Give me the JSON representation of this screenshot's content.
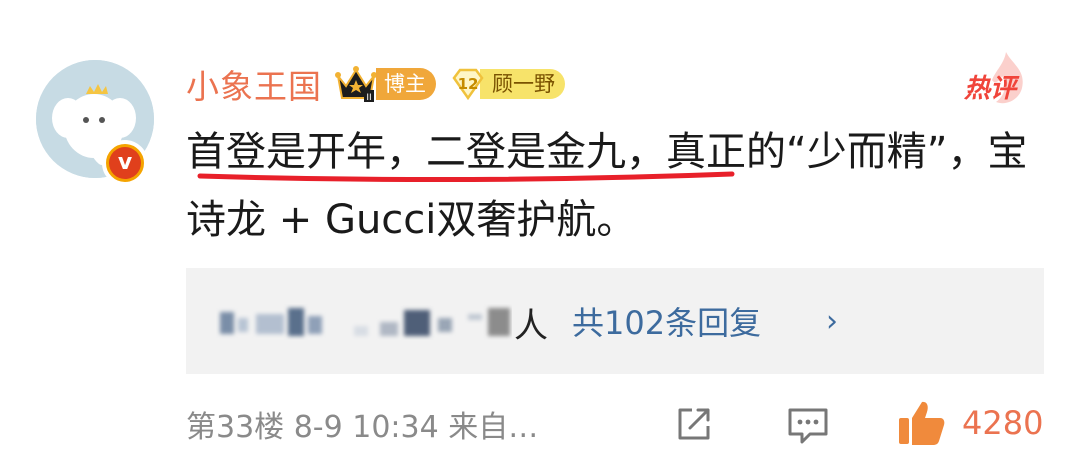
{
  "comment": {
    "username": "小象王国",
    "blogger_tag": "博主",
    "fan_level": "12",
    "fan_name": "顾一野",
    "hot_label": "热评",
    "text": "首登是开年，二登是金九，真正的“少而精”，宝诗龙 + Gucci双奢护航。",
    "reply_suffix": "人",
    "reply_count_text": "共102条回复",
    "reply_chevron": "›",
    "meta": "第33楼  8-9 10:34  来自…",
    "like_count": "4280"
  },
  "colors": {
    "username": "#eb7350",
    "link": "#3d6b9e",
    "hot": "#f0443a",
    "underline": "#e8202a",
    "like": "#f08a3c"
  },
  "icons": {
    "avatar": "elephant-avatar",
    "verified": "v-badge-icon",
    "crown": "crown-icon",
    "fan_level": "diamond-level-icon",
    "share": "share-icon",
    "comment": "comment-icon",
    "like": "thumbs-up-icon"
  }
}
